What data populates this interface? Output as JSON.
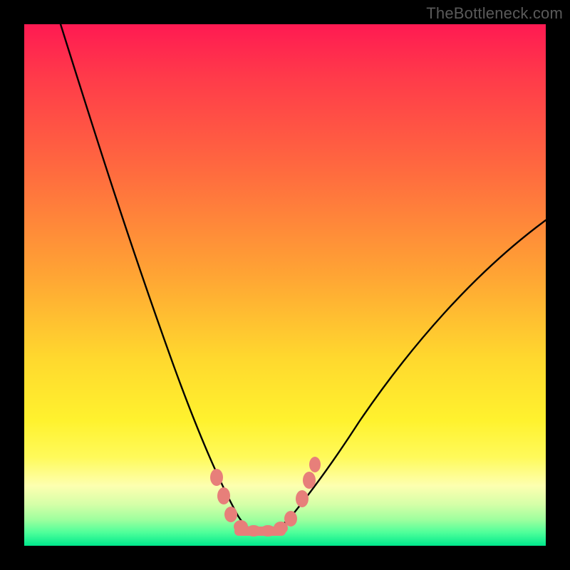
{
  "watermark": "TheBottleneck.com",
  "chart_data": {
    "type": "line",
    "title": "",
    "xlabel": "",
    "ylabel": "",
    "xlim": [
      0,
      100
    ],
    "ylim": [
      0,
      100
    ],
    "grid": false,
    "legend": false,
    "description": "V-shaped bottleneck curve over a vertical heat gradient (red at top = severe bottleneck, green at bottom = balanced). Minimum of the curve sits near x≈45 at y≈3. Pink bead markers highlight the near-optimal region around the trough.",
    "series": [
      {
        "name": "bottleneck-curve-left",
        "x": [
          7,
          12,
          18,
          24,
          30,
          35,
          38,
          41,
          43,
          45
        ],
        "y": [
          100,
          82,
          62,
          44,
          28,
          16,
          10,
          6,
          4,
          3
        ]
      },
      {
        "name": "bottleneck-curve-right",
        "x": [
          45,
          48,
          51,
          55,
          62,
          72,
          85,
          100
        ],
        "y": [
          3,
          4,
          6,
          10,
          18,
          30,
          46,
          62
        ]
      }
    ],
    "markers": [
      {
        "x": 37,
        "y": 13
      },
      {
        "x": 38.5,
        "y": 9
      },
      {
        "x": 40,
        "y": 6
      },
      {
        "x": 42,
        "y": 4
      },
      {
        "x": 44,
        "y": 3.2
      },
      {
        "x": 46,
        "y": 3
      },
      {
        "x": 48,
        "y": 3.2
      },
      {
        "x": 50,
        "y": 4
      },
      {
        "x": 52.5,
        "y": 8
      },
      {
        "x": 54,
        "y": 12
      },
      {
        "x": 55,
        "y": 15
      }
    ],
    "flat_bar": {
      "x_start": 41,
      "x_end": 50,
      "y": 3
    }
  }
}
